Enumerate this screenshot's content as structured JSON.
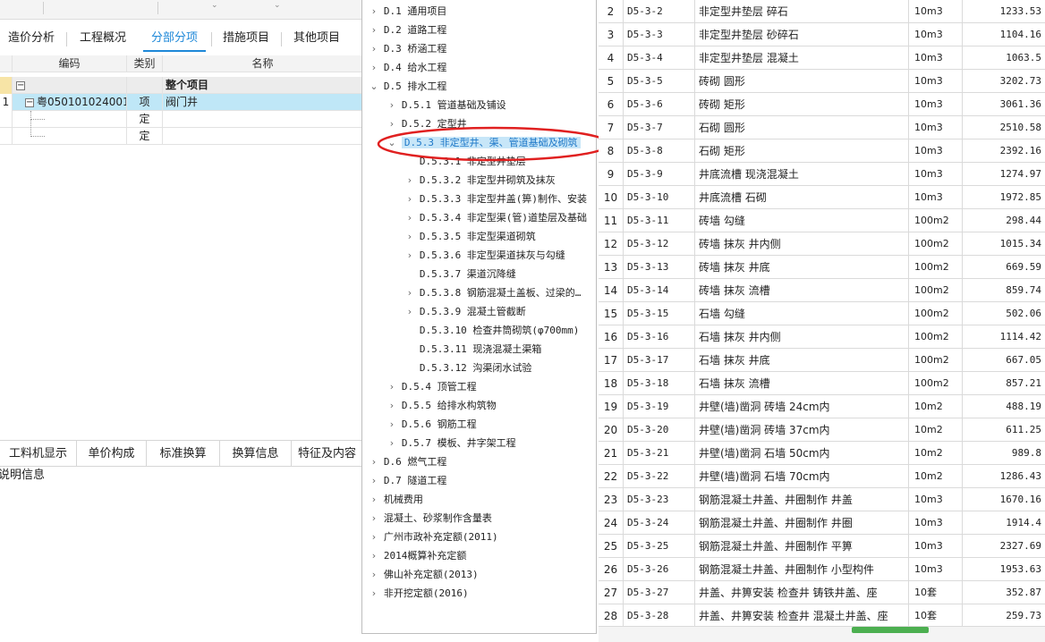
{
  "main_tabs": [
    {
      "label": "造价分析"
    },
    {
      "label": "工程概况"
    },
    {
      "label": "分部分项"
    },
    {
      "label": "措施项目"
    },
    {
      "label": "其他项目"
    }
  ],
  "grid": {
    "headers": [
      "编码",
      "类别",
      "名称"
    ],
    "total_row": {
      "expander": "−",
      "name": "整个项目"
    },
    "rows": [
      {
        "num": "1",
        "expander": "−",
        "code": "粤050101024001",
        "type": "项",
        "name": "阀门井"
      },
      {
        "num": "",
        "code": "",
        "type": "定",
        "name": ""
      },
      {
        "num": "",
        "code": "",
        "type": "定",
        "name": ""
      }
    ]
  },
  "bottom_tabs": [
    "工料机显示",
    "单价构成",
    "标准换算",
    "换算信息",
    "特征及内容"
  ],
  "explain_label": "说明信息",
  "tree": [
    {
      "level": 0,
      "chev": "›",
      "label": "D.1 通用项目"
    },
    {
      "level": 0,
      "chev": "›",
      "label": "D.2 道路工程"
    },
    {
      "level": 0,
      "chev": "›",
      "label": "D.3 桥涵工程"
    },
    {
      "level": 0,
      "chev": "›",
      "label": "D.4 给水工程"
    },
    {
      "level": 0,
      "chev": "⌄",
      "label": "D.5 排水工程"
    },
    {
      "level": 1,
      "chev": "›",
      "label": "D.5.1 管道基础及铺设"
    },
    {
      "level": 1,
      "chev": "›",
      "label": "D.5.2 定型井"
    },
    {
      "level": 1,
      "chev": "⌄",
      "label": "D.5.3 非定型井、渠、管道基础及砌筑",
      "selected": true
    },
    {
      "level": 2,
      "chev": "",
      "label": "D.5.3.1 非定型井垫层"
    },
    {
      "level": 2,
      "chev": "›",
      "label": "D.5.3.2 非定型井砌筑及抹灰"
    },
    {
      "level": 2,
      "chev": "›",
      "label": "D.5.3.3 非定型井盖(箅)制作、安装"
    },
    {
      "level": 2,
      "chev": "›",
      "label": "D.5.3.4 非定型渠(管)道垫层及基础"
    },
    {
      "level": 2,
      "chev": "›",
      "label": "D.5.3.5 非定型渠道砌筑"
    },
    {
      "level": 2,
      "chev": "›",
      "label": "D.5.3.6 非定型渠道抹灰与勾缝"
    },
    {
      "level": 2,
      "chev": "",
      "label": "D.5.3.7 渠道沉降缝"
    },
    {
      "level": 2,
      "chev": "›",
      "label": "D.5.3.8 钢筋混凝土盖板、过梁的…"
    },
    {
      "level": 2,
      "chev": "›",
      "label": "D.5.3.9 混凝土管截断"
    },
    {
      "level": 2,
      "chev": "",
      "label": "D.5.3.10 检查井筒砌筑(φ700mm)"
    },
    {
      "level": 2,
      "chev": "",
      "label": "D.5.3.11 现浇混凝土渠箱"
    },
    {
      "level": 2,
      "chev": "",
      "label": "D.5.3.12 沟渠闭水试验"
    },
    {
      "level": 1,
      "chev": "›",
      "label": "D.5.4 顶管工程"
    },
    {
      "level": 1,
      "chev": "›",
      "label": "D.5.5 给排水构筑物"
    },
    {
      "level": 1,
      "chev": "›",
      "label": "D.5.6 钢筋工程"
    },
    {
      "level": 1,
      "chev": "›",
      "label": "D.5.7 模板、井字架工程"
    },
    {
      "level": 0,
      "chev": "›",
      "label": "D.6 燃气工程"
    },
    {
      "level": 0,
      "chev": "›",
      "label": "D.7 隧道工程"
    },
    {
      "level": 0,
      "chev": "›",
      "label": "机械费用"
    },
    {
      "level": 0,
      "chev": "›",
      "label": "混凝土、砂浆制作含量表"
    },
    {
      "level": 0,
      "chev": "›",
      "label": "广州市政补充定额(2011)"
    },
    {
      "level": 0,
      "chev": "›",
      "label": "2014概算补充定额"
    },
    {
      "level": 0,
      "chev": "›",
      "label": "佛山补充定额(2013)"
    },
    {
      "level": 0,
      "chev": "›",
      "label": "非开挖定额(2016)"
    }
  ],
  "right_rows": [
    {
      "num": "2",
      "code": "D5-3-2",
      "name": "非定型井垫层 碎石",
      "unit": "10m3",
      "price": "1233.53"
    },
    {
      "num": "3",
      "code": "D5-3-3",
      "name": "非定型井垫层 砂碎石",
      "unit": "10m3",
      "price": "1104.16"
    },
    {
      "num": "4",
      "code": "D5-3-4",
      "name": "非定型井垫层 混凝土",
      "unit": "10m3",
      "price": "1063.5"
    },
    {
      "num": "5",
      "code": "D5-3-5",
      "name": "砖砌 圆形",
      "unit": "10m3",
      "price": "3202.73"
    },
    {
      "num": "6",
      "code": "D5-3-6",
      "name": "砖砌 矩形",
      "unit": "10m3",
      "price": "3061.36"
    },
    {
      "num": "7",
      "code": "D5-3-7",
      "name": "石砌 圆形",
      "unit": "10m3",
      "price": "2510.58"
    },
    {
      "num": "8",
      "code": "D5-3-8",
      "name": "石砌 矩形",
      "unit": "10m3",
      "price": "2392.16"
    },
    {
      "num": "9",
      "code": "D5-3-9",
      "name": "井底流槽 现浇混凝土",
      "unit": "10m3",
      "price": "1274.97"
    },
    {
      "num": "10",
      "code": "D5-3-10",
      "name": "井底流槽 石砌",
      "unit": "10m3",
      "price": "1972.85"
    },
    {
      "num": "11",
      "code": "D5-3-11",
      "name": "砖墙 勾缝",
      "unit": "100m2",
      "price": "298.44"
    },
    {
      "num": "12",
      "code": "D5-3-12",
      "name": "砖墙 抹灰 井内侧",
      "unit": "100m2",
      "price": "1015.34"
    },
    {
      "num": "13",
      "code": "D5-3-13",
      "name": "砖墙 抹灰 井底",
      "unit": "100m2",
      "price": "669.59"
    },
    {
      "num": "14",
      "code": "D5-3-14",
      "name": "砖墙 抹灰 流槽",
      "unit": "100m2",
      "price": "859.74"
    },
    {
      "num": "15",
      "code": "D5-3-15",
      "name": "石墙 勾缝",
      "unit": "100m2",
      "price": "502.06"
    },
    {
      "num": "16",
      "code": "D5-3-16",
      "name": "石墙 抹灰 井内侧",
      "unit": "100m2",
      "price": "1114.42"
    },
    {
      "num": "17",
      "code": "D5-3-17",
      "name": "石墙 抹灰 井底",
      "unit": "100m2",
      "price": "667.05"
    },
    {
      "num": "18",
      "code": "D5-3-18",
      "name": "石墙 抹灰 流槽",
      "unit": "100m2",
      "price": "857.21"
    },
    {
      "num": "19",
      "code": "D5-3-19",
      "name": "井壁(墙)凿洞 砖墙 24cm内",
      "unit": "10m2",
      "price": "488.19"
    },
    {
      "num": "20",
      "code": "D5-3-20",
      "name": "井壁(墙)凿洞 砖墙 37cm内",
      "unit": "10m2",
      "price": "611.25"
    },
    {
      "num": "21",
      "code": "D5-3-21",
      "name": "井壁(墙)凿洞 石墙 50cm内",
      "unit": "10m2",
      "price": "989.8"
    },
    {
      "num": "22",
      "code": "D5-3-22",
      "name": "井壁(墙)凿洞 石墙 70cm内",
      "unit": "10m2",
      "price": "1286.43"
    },
    {
      "num": "23",
      "code": "D5-3-23",
      "name": "钢筋混凝土井盖、井圈制作 井盖",
      "unit": "10m3",
      "price": "1670.16"
    },
    {
      "num": "24",
      "code": "D5-3-24",
      "name": "钢筋混凝土井盖、井圈制作 井圈",
      "unit": "10m3",
      "price": "1914.4"
    },
    {
      "num": "25",
      "code": "D5-3-25",
      "name": "钢筋混凝土井盖、井圈制作 平箅",
      "unit": "10m3",
      "price": "2327.69"
    },
    {
      "num": "26",
      "code": "D5-3-26",
      "name": "钢筋混凝土井盖、井圈制作 小型构件",
      "unit": "10m3",
      "price": "1953.63"
    },
    {
      "num": "27",
      "code": "D5-3-27",
      "name": "井盖、井箅安装 检查井 铸铁井盖、座",
      "unit": "10套",
      "price": "352.87"
    },
    {
      "num": "28",
      "code": "D5-3-28",
      "name": "井盖、井箅安装 检查井 混凝土井盖、座",
      "unit": "10套",
      "price": "259.73"
    }
  ]
}
